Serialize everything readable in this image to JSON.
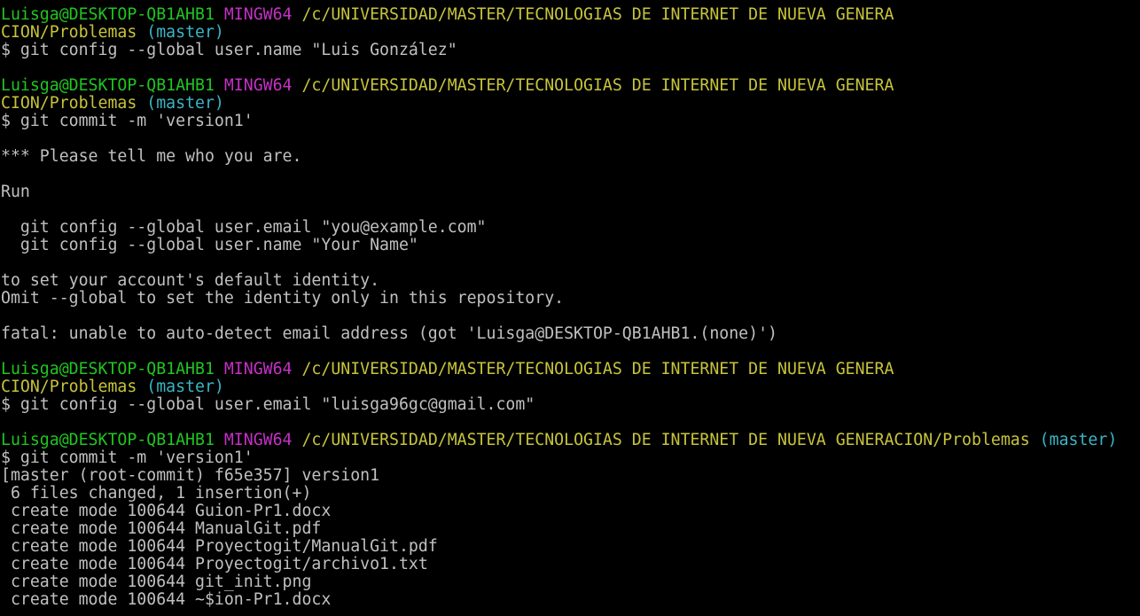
{
  "colors": {
    "background": "#000000",
    "default": "#c0c0c0",
    "user": "#21c521",
    "mingw": "#c531c5",
    "path": "#c7c43b",
    "branch": "#3ab5c4"
  },
  "lines": [
    [
      {
        "t": "Luisga@DESKTOP-QB1AHB1",
        "c": "user"
      },
      {
        "t": " ",
        "c": "default"
      },
      {
        "t": "MINGW64",
        "c": "mingw"
      },
      {
        "t": " ",
        "c": "default"
      },
      {
        "t": "/c/UNIVERSIDAD/MÁSTER/TECNOLOGÍAS DE INTERNET DE NUEVA GENERA",
        "c": "path"
      }
    ],
    [
      {
        "t": "CIÓN/Problemas",
        "c": "path"
      },
      {
        "t": " ",
        "c": "default"
      },
      {
        "t": "(master)",
        "c": "branch"
      }
    ],
    [
      {
        "t": "$ git config --global user.name \"Luis González\"",
        "c": "default"
      }
    ],
    [],
    [
      {
        "t": "Luisga@DESKTOP-QB1AHB1",
        "c": "user"
      },
      {
        "t": " ",
        "c": "default"
      },
      {
        "t": "MINGW64",
        "c": "mingw"
      },
      {
        "t": " ",
        "c": "default"
      },
      {
        "t": "/c/UNIVERSIDAD/MÁSTER/TECNOLOGÍAS DE INTERNET DE NUEVA GENERA",
        "c": "path"
      }
    ],
    [
      {
        "t": "CIÓN/Problemas",
        "c": "path"
      },
      {
        "t": " ",
        "c": "default"
      },
      {
        "t": "(master)",
        "c": "branch"
      }
    ],
    [
      {
        "t": "$ git commit -m 'version1'",
        "c": "default"
      }
    ],
    [],
    [
      {
        "t": "*** Please tell me who you are.",
        "c": "default"
      }
    ],
    [],
    [
      {
        "t": "Run",
        "c": "default"
      }
    ],
    [],
    [
      {
        "t": "  git config --global user.email \"you@example.com\"",
        "c": "default"
      }
    ],
    [
      {
        "t": "  git config --global user.name \"Your Name\"",
        "c": "default"
      }
    ],
    [],
    [
      {
        "t": "to set your account's default identity.",
        "c": "default"
      }
    ],
    [
      {
        "t": "Omit --global to set the identity only in this repository.",
        "c": "default"
      }
    ],
    [],
    [
      {
        "t": "fatal: unable to auto-detect email address (got 'Luisga@DESKTOP-QB1AHB1.(none)')",
        "c": "default"
      }
    ],
    [],
    [
      {
        "t": "Luisga@DESKTOP-QB1AHB1",
        "c": "user"
      },
      {
        "t": " ",
        "c": "default"
      },
      {
        "t": "MINGW64",
        "c": "mingw"
      },
      {
        "t": " ",
        "c": "default"
      },
      {
        "t": "/c/UNIVERSIDAD/MÁSTER/TECNOLOGÍAS DE INTERNET DE NUEVA GENERA",
        "c": "path"
      }
    ],
    [
      {
        "t": "CIÓN/Problemas",
        "c": "path"
      },
      {
        "t": " ",
        "c": "default"
      },
      {
        "t": "(master)",
        "c": "branch"
      }
    ],
    [
      {
        "t": "$ git config --global user.email \"luisga96gc@gmail.com\"",
        "c": "default"
      }
    ],
    [],
    [
      {
        "t": "Luisga@DESKTOP-QB1AHB1",
        "c": "user"
      },
      {
        "t": " ",
        "c": "default"
      },
      {
        "t": "MINGW64",
        "c": "mingw"
      },
      {
        "t": " ",
        "c": "default"
      },
      {
        "t": "/c/UNIVERSIDAD/MÁSTER/TECNOLOGÍAS DE INTERNET DE NUEVA GENERACIÓN/Problemas",
        "c": "path"
      },
      {
        "t": " ",
        "c": "default"
      },
      {
        "t": "(master)",
        "c": "branch"
      }
    ],
    [
      {
        "t": "$ git commit -m 'version1'",
        "c": "default"
      }
    ],
    [
      {
        "t": "[master (root-commit) f65e357] version1",
        "c": "default"
      }
    ],
    [
      {
        "t": " 6 files changed, 1 insertion(+)",
        "c": "default"
      }
    ],
    [
      {
        "t": " create mode 100644 Guion-Pr1.docx",
        "c": "default"
      }
    ],
    [
      {
        "t": " create mode 100644 ManualGit.pdf",
        "c": "default"
      }
    ],
    [
      {
        "t": " create mode 100644 Proyectogit/ManualGit.pdf",
        "c": "default"
      }
    ],
    [
      {
        "t": " create mode 100644 Proyectogit/archivo1.txt",
        "c": "default"
      }
    ],
    [
      {
        "t": " create mode 100644 git_init.png",
        "c": "default"
      }
    ],
    [
      {
        "t": " create mode 100644 ~$ion-Pr1.docx",
        "c": "default"
      }
    ]
  ]
}
